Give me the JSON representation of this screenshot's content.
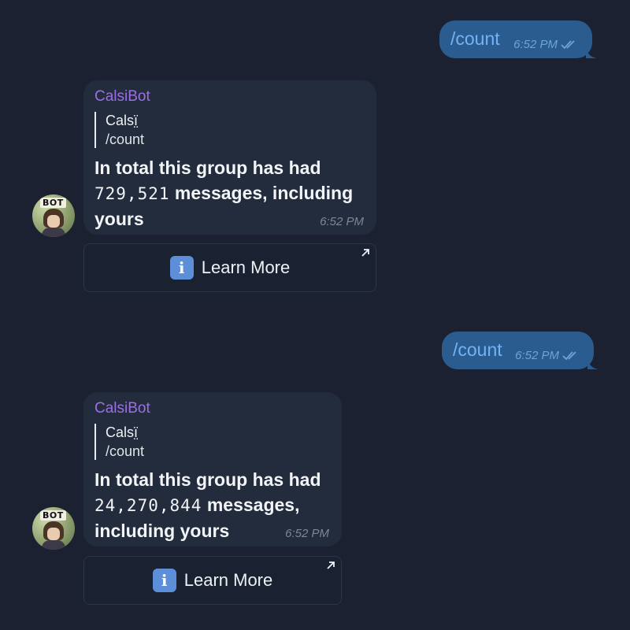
{
  "messages": [
    {
      "outgoing": {
        "text": "/count",
        "time": "6:52 PM"
      },
      "incoming": {
        "sender": "CalsiBot",
        "reply_name": "Calsï̤",
        "reply_text": "/count",
        "text_before": "In total this group has had",
        "count": "729,521",
        "text_after_line1": " messages, including",
        "text_after_line2": "yours",
        "time": "6:52 PM",
        "avatar_badge": "BOT",
        "button_label": "Learn More",
        "button_icon": "info-icon"
      }
    },
    {
      "outgoing": {
        "text": "/count",
        "time": "6:52 PM"
      },
      "incoming": {
        "sender": "CalsiBot",
        "reply_name": "Calsï̤",
        "reply_text": "/count",
        "text_before": "In total this group has had",
        "count": "24,270,844",
        "text_after_line1": " messages,",
        "text_after_line2": "including yours",
        "time": "6:52 PM",
        "avatar_badge": "BOT",
        "button_label": "Learn More",
        "button_icon": "info-icon"
      }
    }
  ],
  "colors": {
    "background": "#1b2130",
    "outgoing_bubble": "#2b5c90",
    "incoming_bubble": "#222c3c",
    "sender_name": "#9c6fe4",
    "info_icon": "#5c8fd8"
  }
}
